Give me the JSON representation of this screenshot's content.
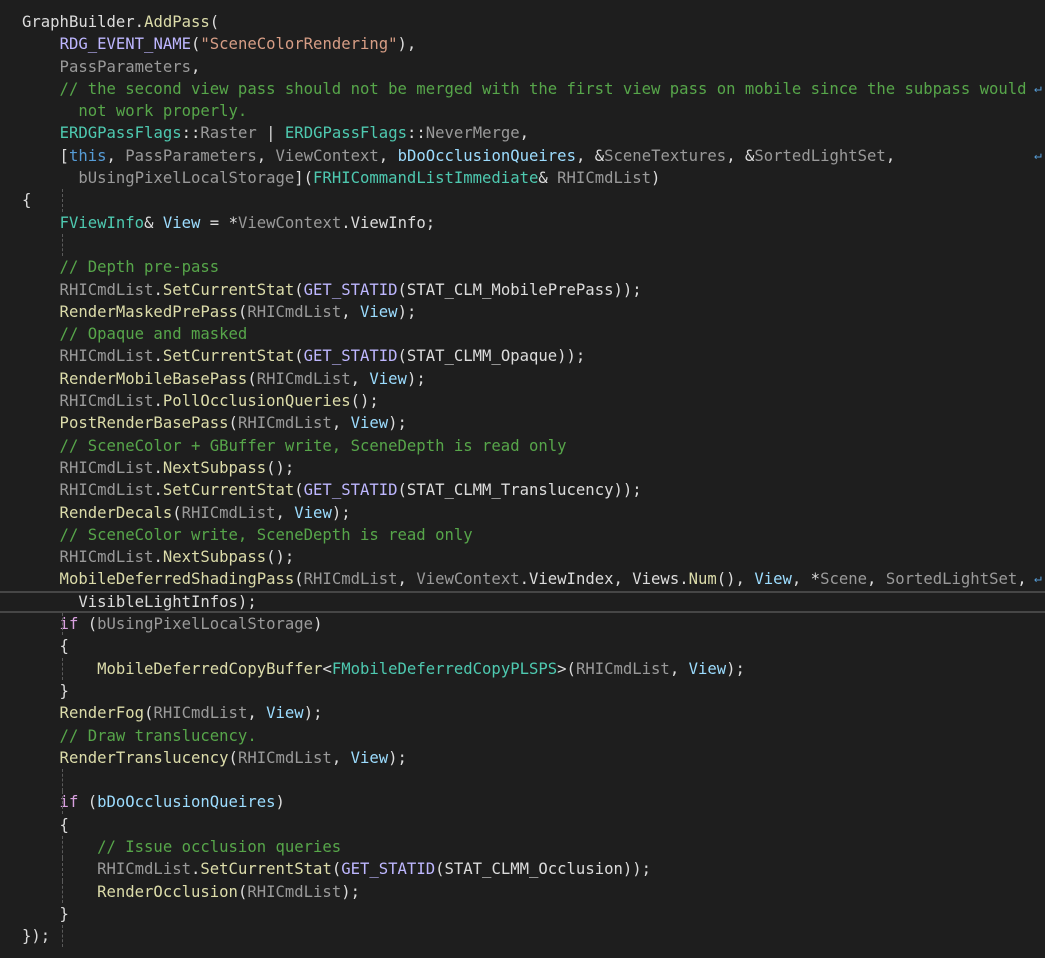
{
  "editor": {
    "current_line": 27,
    "wrap_icon": "↵",
    "lines": [
      {
        "t": [
          [
            "d",
            "GraphBuilder."
          ],
          [
            "f",
            "AddPass"
          ],
          [
            "d",
            "("
          ]
        ]
      },
      {
        "t": [
          [
            "d",
            "    "
          ],
          [
            "m",
            "RDG_EVENT_NAME"
          ],
          [
            "d",
            "("
          ],
          [
            "s",
            "\"SceneColorRendering\""
          ],
          [
            "d",
            "),"
          ]
        ]
      },
      {
        "t": [
          [
            "p",
            "    PassParameters"
          ],
          [
            "d",
            ","
          ]
        ]
      },
      {
        "t": [
          [
            "c",
            "    // the second view pass should not be merged with the first view pass on mobile since the subpass would"
          ]
        ],
        "wrap": true
      },
      {
        "t": [
          [
            "c",
            "      not work properly."
          ]
        ]
      },
      {
        "t": [
          [
            "d",
            "    "
          ],
          [
            "t",
            "ERDGPassFlags"
          ],
          [
            "d",
            "::"
          ],
          [
            "p",
            "Raster"
          ],
          [
            "d",
            " | "
          ],
          [
            "t",
            "ERDGPassFlags"
          ],
          [
            "d",
            "::"
          ],
          [
            "p",
            "NeverMerge"
          ],
          [
            "d",
            ","
          ]
        ]
      },
      {
        "t": [
          [
            "d",
            "    ["
          ],
          [
            "k",
            "this"
          ],
          [
            "d",
            ", "
          ],
          [
            "p",
            "PassParameters"
          ],
          [
            "d",
            ", "
          ],
          [
            "p",
            "ViewContext"
          ],
          [
            "d",
            ", "
          ],
          [
            "l",
            "bDoOcclusionQueires"
          ],
          [
            "d",
            ", &"
          ],
          [
            "p",
            "SceneTextures"
          ],
          [
            "d",
            ", &"
          ],
          [
            "p",
            "SortedLightSet"
          ],
          [
            "d",
            ","
          ]
        ],
        "wrap": true
      },
      {
        "t": [
          [
            "p",
            "      bUsingPixelLocalStorage"
          ],
          [
            "d",
            "]("
          ],
          [
            "t",
            "FRHICommandListImmediate"
          ],
          [
            "d",
            "& "
          ],
          [
            "p",
            "RHICmdList"
          ],
          [
            "d",
            ")"
          ]
        ]
      },
      {
        "t": [
          [
            "d",
            "{"
          ]
        ]
      },
      {
        "t": [
          [
            "d",
            "    "
          ],
          [
            "t",
            "FViewInfo"
          ],
          [
            "d",
            "& "
          ],
          [
            "l",
            "View"
          ],
          [
            "d",
            " = *"
          ],
          [
            "p",
            "ViewContext"
          ],
          [
            "d",
            ".ViewInfo;"
          ]
        ]
      },
      {
        "t": [
          [
            "d",
            ""
          ]
        ]
      },
      {
        "t": [
          [
            "c",
            "    // Depth pre-pass"
          ]
        ]
      },
      {
        "t": [
          [
            "p",
            "    RHICmdList"
          ],
          [
            "d",
            "."
          ],
          [
            "f",
            "SetCurrentStat"
          ],
          [
            "d",
            "("
          ],
          [
            "m",
            "GET_STATID"
          ],
          [
            "d",
            "(STAT_CLM_MobilePrePass));"
          ]
        ]
      },
      {
        "t": [
          [
            "f",
            "    RenderMaskedPrePass"
          ],
          [
            "d",
            "("
          ],
          [
            "p",
            "RHICmdList"
          ],
          [
            "d",
            ", "
          ],
          [
            "l",
            "View"
          ],
          [
            "d",
            ");"
          ]
        ]
      },
      {
        "t": [
          [
            "c",
            "    // Opaque and masked"
          ]
        ]
      },
      {
        "t": [
          [
            "p",
            "    RHICmdList"
          ],
          [
            "d",
            "."
          ],
          [
            "f",
            "SetCurrentStat"
          ],
          [
            "d",
            "("
          ],
          [
            "m",
            "GET_STATID"
          ],
          [
            "d",
            "(STAT_CLMM_Opaque));"
          ]
        ]
      },
      {
        "t": [
          [
            "f",
            "    RenderMobileBasePass"
          ],
          [
            "d",
            "("
          ],
          [
            "p",
            "RHICmdList"
          ],
          [
            "d",
            ", "
          ],
          [
            "l",
            "View"
          ],
          [
            "d",
            ");"
          ]
        ]
      },
      {
        "t": [
          [
            "p",
            "    RHICmdList"
          ],
          [
            "d",
            "."
          ],
          [
            "f",
            "PollOcclusionQueries"
          ],
          [
            "d",
            "();"
          ]
        ]
      },
      {
        "t": [
          [
            "f",
            "    PostRenderBasePass"
          ],
          [
            "d",
            "("
          ],
          [
            "p",
            "RHICmdList"
          ],
          [
            "d",
            ", "
          ],
          [
            "l",
            "View"
          ],
          [
            "d",
            ");"
          ]
        ]
      },
      {
        "t": [
          [
            "c",
            "    // SceneColor + GBuffer write, SceneDepth is read only"
          ]
        ]
      },
      {
        "t": [
          [
            "p",
            "    RHICmdList"
          ],
          [
            "d",
            "."
          ],
          [
            "f",
            "NextSubpass"
          ],
          [
            "d",
            "();"
          ]
        ]
      },
      {
        "t": [
          [
            "p",
            "    RHICmdList"
          ],
          [
            "d",
            "."
          ],
          [
            "f",
            "SetCurrentStat"
          ],
          [
            "d",
            "("
          ],
          [
            "m",
            "GET_STATID"
          ],
          [
            "d",
            "(STAT_CLMM_Translucency));"
          ]
        ]
      },
      {
        "t": [
          [
            "f",
            "    RenderDecals"
          ],
          [
            "d",
            "("
          ],
          [
            "p",
            "RHICmdList"
          ],
          [
            "d",
            ", "
          ],
          [
            "l",
            "View"
          ],
          [
            "d",
            ");"
          ]
        ]
      },
      {
        "t": [
          [
            "c",
            "    // SceneColor write, SceneDepth is read only"
          ]
        ]
      },
      {
        "t": [
          [
            "p",
            "    RHICmdList"
          ],
          [
            "d",
            "."
          ],
          [
            "f",
            "NextSubpass"
          ],
          [
            "d",
            "();"
          ]
        ]
      },
      {
        "t": [
          [
            "f",
            "    MobileDeferredShadingPass"
          ],
          [
            "d",
            "("
          ],
          [
            "p",
            "RHICmdList"
          ],
          [
            "d",
            ", "
          ],
          [
            "p",
            "ViewContext"
          ],
          [
            "d",
            ".ViewIndex, Views."
          ],
          [
            "f",
            "Num"
          ],
          [
            "d",
            "(), "
          ],
          [
            "l",
            "View"
          ],
          [
            "d",
            ", *"
          ],
          [
            "p",
            "Scene"
          ],
          [
            "d",
            ", "
          ],
          [
            "p",
            "SortedLightSet"
          ],
          [
            "d",
            ","
          ]
        ],
        "wrap": true
      },
      {
        "t": [
          [
            "d",
            "      VisibleLightInfos);"
          ]
        ]
      },
      {
        "t": [
          [
            "cf",
            "    if"
          ],
          [
            "d",
            " ("
          ],
          [
            "p",
            "bUsingPixelLocalStorage"
          ],
          [
            "d",
            ")"
          ]
        ]
      },
      {
        "t": [
          [
            "d",
            "    {"
          ]
        ]
      },
      {
        "t": [
          [
            "f",
            "        MobileDeferredCopyBuffer"
          ],
          [
            "d",
            "<"
          ],
          [
            "t",
            "FMobileDeferredCopyPLSPS"
          ],
          [
            "d",
            ">("
          ],
          [
            "p",
            "RHICmdList"
          ],
          [
            "d",
            ", "
          ],
          [
            "l",
            "View"
          ],
          [
            "d",
            ");"
          ]
        ]
      },
      {
        "t": [
          [
            "d",
            "    }"
          ]
        ]
      },
      {
        "t": [
          [
            "f",
            "    RenderFog"
          ],
          [
            "d",
            "("
          ],
          [
            "p",
            "RHICmdList"
          ],
          [
            "d",
            ", "
          ],
          [
            "l",
            "View"
          ],
          [
            "d",
            ");"
          ]
        ]
      },
      {
        "t": [
          [
            "c",
            "    // Draw translucency."
          ]
        ]
      },
      {
        "t": [
          [
            "f",
            "    RenderTranslucency"
          ],
          [
            "d",
            "("
          ],
          [
            "p",
            "RHICmdList"
          ],
          [
            "d",
            ", "
          ],
          [
            "l",
            "View"
          ],
          [
            "d",
            ");"
          ]
        ]
      },
      {
        "t": [
          [
            "d",
            ""
          ]
        ]
      },
      {
        "t": [
          [
            "cf",
            "    if"
          ],
          [
            "d",
            " ("
          ],
          [
            "l",
            "bDoOcclusionQueires"
          ],
          [
            "d",
            ")"
          ]
        ]
      },
      {
        "t": [
          [
            "d",
            "    {"
          ]
        ]
      },
      {
        "t": [
          [
            "c",
            "        // Issue occlusion queries"
          ]
        ]
      },
      {
        "t": [
          [
            "p",
            "        RHICmdList"
          ],
          [
            "d",
            "."
          ],
          [
            "f",
            "SetCurrentStat"
          ],
          [
            "d",
            "("
          ],
          [
            "m",
            "GET_STATID"
          ],
          [
            "d",
            "(STAT_CLMM_Occlusion));"
          ]
        ]
      },
      {
        "t": [
          [
            "f",
            "        RenderOcclusion"
          ],
          [
            "d",
            "("
          ],
          [
            "p",
            "RHICmdList"
          ],
          [
            "d",
            ");"
          ]
        ]
      },
      {
        "t": [
          [
            "d",
            "    }"
          ]
        ]
      },
      {
        "t": [
          [
            "d",
            "});"
          ]
        ]
      }
    ]
  }
}
